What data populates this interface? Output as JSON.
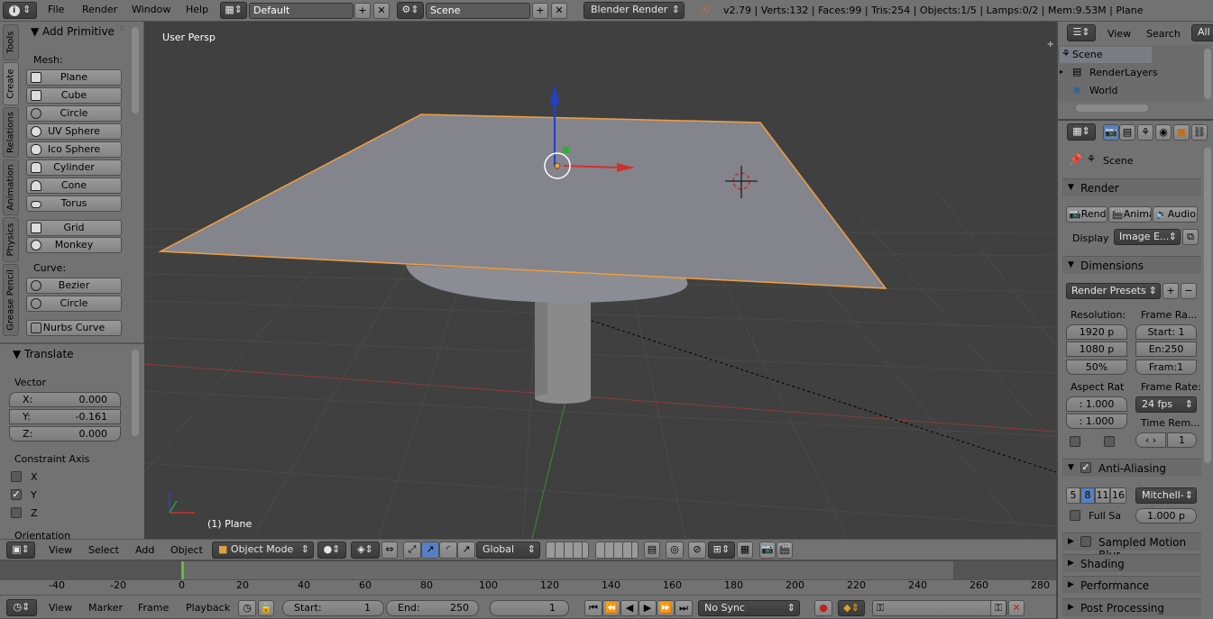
{
  "top_bar": {
    "menus": [
      "File",
      "Render",
      "Window",
      "Help"
    ],
    "layout": "Default",
    "scene": "Scene",
    "engine": "Blender Render",
    "stats": "v2.79 | Verts:132 | Faces:99 | Tris:254 | Objects:1/5 | Lamps:0/2 | Mem:9.53M | Plane"
  },
  "tool_tabs": [
    "Tools",
    "Create",
    "Relations",
    "Animation",
    "Physics",
    "Grease Pencil"
  ],
  "tool_panel": {
    "title": "Add Primitive",
    "mesh_label": "Mesh:",
    "mesh_items": [
      "Plane",
      "Cube",
      "Circle",
      "UV Sphere",
      "Ico Sphere",
      "Cylinder",
      "Cone",
      "Torus"
    ],
    "extra_items": [
      "Grid",
      "Monkey"
    ],
    "curve_label": "Curve:",
    "curve_items": [
      "Bezier",
      "Circle"
    ],
    "other_items": [
      "Nurbs Curve"
    ]
  },
  "operator_panel": {
    "title": "Translate",
    "vector_label": "Vector",
    "x_label": "X:",
    "x_value": "0.000",
    "y_label": "Y:",
    "y_value": "-0.161",
    "z_label": "Z:",
    "z_value": "0.000",
    "constraint_label": "Constraint Axis",
    "axes": [
      {
        "label": "X",
        "checked": false
      },
      {
        "label": "Y",
        "checked": true
      },
      {
        "label": "Z",
        "checked": false
      }
    ],
    "orientation_label": "Orientation"
  },
  "viewport": {
    "view_label": "User Persp",
    "object_label": "(1) Plane"
  },
  "view_header": {
    "menus": [
      "View",
      "Select",
      "Add",
      "Object"
    ],
    "mode": "Object Mode",
    "orientation": "Global"
  },
  "timeline": {
    "ticks": [
      "-40",
      "-20",
      "0",
      "20",
      "40",
      "60",
      "80",
      "100",
      "120",
      "140",
      "160",
      "180",
      "200",
      "220",
      "240",
      "260",
      "280"
    ],
    "menus": [
      "View",
      "Marker",
      "Frame",
      "Playback"
    ],
    "start_label": "Start:",
    "start_value": "1",
    "end_label": "End:",
    "end_value": "250",
    "current": "1",
    "sync": "No Sync"
  },
  "outliner": {
    "menus": [
      "View",
      "Search",
      "All S"
    ],
    "items": [
      "Scene",
      "RenderLayers",
      "World"
    ]
  },
  "properties": {
    "context": "Scene",
    "render_header": "Render",
    "render_buttons": [
      "Rend",
      "Anima",
      "Audio"
    ],
    "display_label": "Display",
    "display_value": "Image E...",
    "dimensions_header": "Dimensions",
    "presets": "Render Presets",
    "resolution_label": "Resolution:",
    "res_x": "1920 p",
    "res_y": "1080 p",
    "res_pct": "50%",
    "frame_range_label": "Frame Ra...",
    "frame_start": "Start: 1",
    "frame_end": "En:250",
    "frame_step": "Fram:1",
    "aspect_label": "Aspect Rat",
    "aspect_x": ": 1.000",
    "aspect_y": ": 1.000",
    "frame_rate_label": "Frame Rate:",
    "fps": "24 fps",
    "time_remap_label": "Time Rem...",
    "time_remap_value": "1",
    "aa_header": "Anti-Aliasing",
    "aa_samples": [
      "5",
      "8",
      "11",
      "16"
    ],
    "aa_filter": "Mitchell-",
    "full_sample": "Full Sa",
    "filter_size": "1.000 p",
    "sections": [
      "Sampled Motion Blur",
      "Shading",
      "Performance",
      "Post Processing"
    ]
  },
  "colors": {
    "viewport_bg": "#404040",
    "panel_bg": "#727272",
    "selection_outline": "#f0a040",
    "x_axis": "#c83232",
    "y_axis": "#32a032",
    "z_axis": "#2040d0"
  }
}
